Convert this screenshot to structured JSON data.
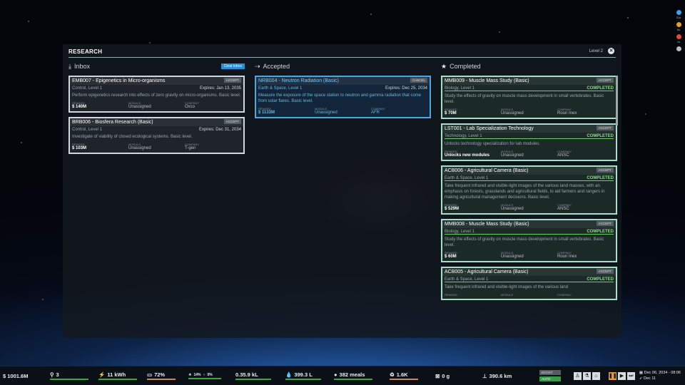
{
  "panel": {
    "title": "RESEARCH",
    "level": "Level 2"
  },
  "columns": {
    "inbox": {
      "title": "Inbox",
      "clear_label": "Clear inbox"
    },
    "accepted": {
      "title": "Accepted"
    },
    "completed": {
      "title": "Completed"
    }
  },
  "inbox": [
    {
      "title": "EMB007 - Epigenetics in Micro-organisms",
      "btn": "ACCEPT",
      "category": "Control, Level 1",
      "expires": "Expires: Jan 13, 2035",
      "desc": "Perform epigenetics research into effects of zero gravity on micro-organisms. Basic level.",
      "reward_label": "REWARD",
      "reward": "$ 140M",
      "module_label": "MODULE",
      "module": "Unassigned",
      "company_label": "COMPANY",
      "company": "Oxco"
    },
    {
      "title": "BRB006 - Biosfera Research (Basic)",
      "btn": "ACCEPT",
      "category": "Control, Level 1",
      "expires": "Expires: Dec 31, 2034",
      "desc": "Investigate of viability of closed ecological systems. Basic level.",
      "reward_label": "REWARD",
      "reward": "$ 103M",
      "module_label": "MODULE",
      "module": "Unassigned",
      "company_label": "COMPANY",
      "company": "T-gen"
    }
  ],
  "accepted": [
    {
      "title": "NRB004 - Neutron Radiation (Basic)",
      "btn": "CANCEL",
      "category": "Earth & Space, Level 1",
      "expires": "Expires: Dec 25, 2034",
      "desc": "Measure the exposure of the space station to neutron and gamma radiation that come from solar flares. Basic level.",
      "reward_label": "REWARD",
      "reward": "$ 1133M",
      "module_label": "MODULE",
      "module": "Unassigned",
      "company_label": "COMPANY",
      "company": "AFR"
    }
  ],
  "completed": [
    {
      "title": "MMB009 - Muscle Mass Study (Basic)",
      "btn": "ACCEPT",
      "category": "Biology, Level 1",
      "status": "COMPLETED",
      "desc": "Study the effects of gravity on muscle mass development in small vertebrates. Basic level.",
      "reward_label": "REWARD",
      "reward": "$ 70M",
      "module_label": "MODULE",
      "module": "Unassigned",
      "company_label": "COMPANY",
      "company": "Roun Inex"
    },
    {
      "title": "LST001 - Lab Specialization Technology",
      "btn": "ACCEPT",
      "category": "Technology, Level 1",
      "status": "COMPLETED",
      "desc": "Unlocks technology specialization for lab modules.",
      "reward_label": "REWARD",
      "reward": "Unlocks new modules",
      "module_label": "MODULE",
      "module": "Unassigned",
      "company_label": "COMPANY",
      "company": "ANSC"
    },
    {
      "title": "ACB006 - Agricultural Camera (Basic)",
      "btn": "ACCEPT",
      "category": "Earth & Space, Level 1",
      "status": "COMPLETED",
      "desc": "Take frequent infrared and visible-light images of the various land masses, with an emphasis on forests, grasslands and agricultural fields, to aid farmers and rangers in making agricultural management decisions. Basic level.",
      "reward_label": "REWARD",
      "reward": "$ 529M",
      "module_label": "MODULE",
      "module": "Unassigned",
      "company_label": "COMPANY",
      "company": "ANSC"
    },
    {
      "title": "MMB008 - Muscle Mass Study (Basic)",
      "btn": "ACCEPT",
      "category": "Biology, Level 1",
      "status": "COMPLETED",
      "desc": "Study the effects of gravity on muscle mass development in small vertebrates. Basic level.",
      "reward_label": "REWARD",
      "reward": "$ 60M",
      "module_label": "MODULE",
      "module": "Unassigned",
      "company_label": "COMPANY",
      "company": "Roun Inex"
    },
    {
      "title": "ACB005 - Agricultural Camera (Basic)",
      "btn": "ACCEPT",
      "category": "Earth & Space, Level 1",
      "status": "COMPLETED",
      "desc": "Take frequent infrared and visible-light images of the various land",
      "reward_label": "REWARD",
      "reward": "",
      "module_label": "MODULE",
      "module": "",
      "company_label": "COMPANY",
      "company": ""
    }
  ],
  "alerts": [
    {
      "label": "31s",
      "color": "#3aa0e0"
    },
    {
      "label": "6s",
      "color": "#e5a020"
    },
    {
      "label": "1s",
      "color": "#e04a3a"
    },
    {
      "label": "",
      "color": "#bbbbbb"
    }
  ],
  "bottom": {
    "money": "$ 1001.6M",
    "crew": "3",
    "power": "11 kWh",
    "water_pct": "72%",
    "o2": "14%",
    "co2": "0%",
    "air": "0.35.9 kL",
    "water": "399.3 L",
    "meals": "382 meals",
    "waste": "1.6K",
    "trash": "0 g",
    "altitude": "390.6 km",
    "alt_btn": "BOOST",
    "alt_btn2": "AUTO",
    "date": "Dec 06, 2034 - 08:06",
    "next": "Dec 11"
  }
}
